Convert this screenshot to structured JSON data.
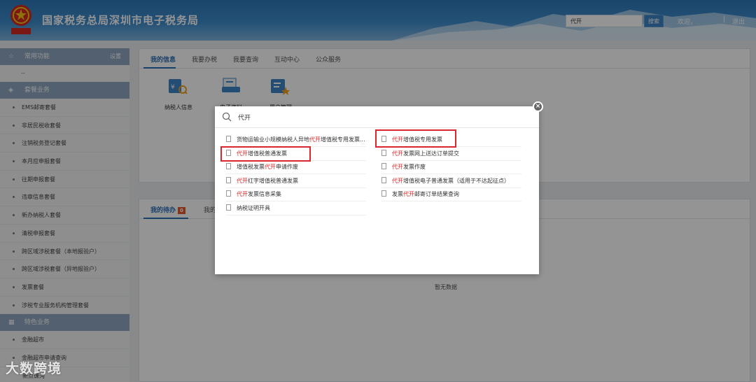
{
  "header": {
    "title": "国家税务总局深圳市电子税务局",
    "search_value": "代开",
    "search_button": "搜索",
    "welcome": "欢迎，",
    "separator": "|",
    "logout": "退出",
    "emblem_text": "中华人民共和国"
  },
  "sidebar": {
    "common": {
      "label": "常用功能",
      "settings": "设置"
    },
    "common_placeholder": "--",
    "package": {
      "label": "套餐业务"
    },
    "package_items": [
      "EMS邮寄套餐",
      "非居民税收套餐",
      "注销税务登记套餐",
      "本月应申报套餐",
      "往期申报套餐",
      "违章信息套餐",
      "新办纳税人套餐",
      "清税申报套餐",
      "跨区域涉税套餐（本地报验户）",
      "跨区域涉税套餐（异地报验户）",
      "发票套餐",
      "涉税专业服务机构管理套餐"
    ],
    "special": {
      "label": "特色业务"
    },
    "special_items": [
      "金融超市",
      "金融超市申请查询"
    ],
    "extra_item": "新点课沟"
  },
  "main": {
    "tabs": [
      "我的信息",
      "我要办税",
      "我要查询",
      "互动中心",
      "公众服务"
    ],
    "icons": [
      "纳税人信息",
      "电子资料",
      "用户管理"
    ],
    "bottom_tabs": {
      "todo": "我的待办",
      "todo_count": "0",
      "other": "我的"
    },
    "no_data": "暂无数据"
  },
  "modal": {
    "query": "代开",
    "left_results": [
      {
        "pre": "货物运输业小规模纳税人异地",
        "hl": "代开",
        "post": "增值税专用发票..."
      },
      {
        "pre": "",
        "hl": "代开",
        "post": "增值税普通发票"
      },
      {
        "pre": "增值税发票",
        "hl": "代开",
        "post": "申请作废"
      },
      {
        "pre": "",
        "hl": "代开",
        "post": "红字增值税普通发票"
      },
      {
        "pre": "",
        "hl": "代开",
        "post": "发票信息采集"
      },
      {
        "pre": "纳税证明开具",
        "hl": "",
        "post": ""
      }
    ],
    "right_results": [
      {
        "pre": "",
        "hl": "代开",
        "post": "增值税专用发票"
      },
      {
        "pre": "",
        "hl": "代开",
        "post": "发票网上送达订单提交"
      },
      {
        "pre": "",
        "hl": "代开",
        "post": "发票作废"
      },
      {
        "pre": "",
        "hl": "代开",
        "post": "增值税电子普通发票（适用于不达起征点）"
      },
      {
        "pre": "发票",
        "hl": "代开",
        "post": "邮寄订单结果查询"
      }
    ]
  },
  "watermark": "大数跨境",
  "colors": {
    "header": "#3a86c8",
    "sidebar_section": "#8da5bf",
    "accent": "#2c6fb6",
    "highlight": "#e02020",
    "box": "#d9272e"
  }
}
